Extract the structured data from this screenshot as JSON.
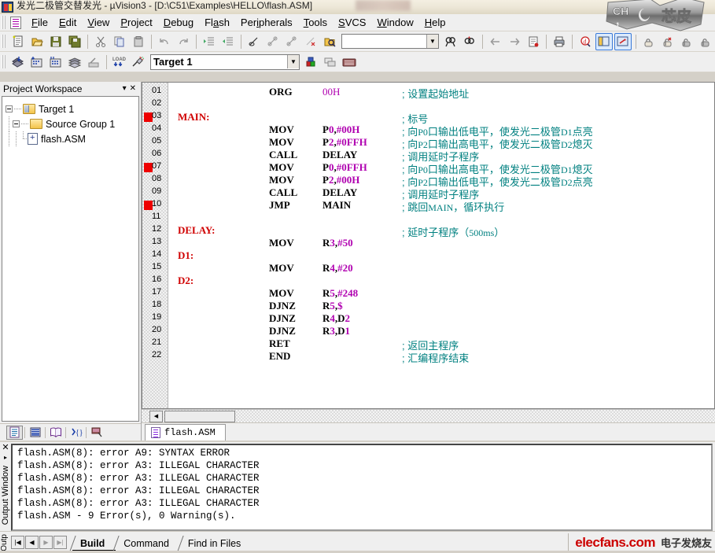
{
  "window": {
    "title": "发光二极管交替发光 - µVision3 - [D:\\C51\\Examples\\HELLO\\flash.ASM]",
    "app_icon": "uvision-icon"
  },
  "menubar": {
    "doc_icon": "document-icon",
    "items": [
      {
        "label": "File",
        "accel": "F"
      },
      {
        "label": "Edit",
        "accel": "E"
      },
      {
        "label": "View",
        "accel": "V"
      },
      {
        "label": "Project",
        "accel": "P"
      },
      {
        "label": "Debug",
        "accel": "D"
      },
      {
        "label": "Flash",
        "accel": "a"
      },
      {
        "label": "Peripherals",
        "accel": "i"
      },
      {
        "label": "Tools",
        "accel": "T"
      },
      {
        "label": "SVCS",
        "accel": "S"
      },
      {
        "label": "Window",
        "accel": "W"
      },
      {
        "label": "Help",
        "accel": "H"
      }
    ]
  },
  "toolbar_file": {
    "buttons": [
      "new-file-icon",
      "open-file-icon",
      "save-icon",
      "save-all-icon",
      "cut-icon",
      "copy-icon",
      "paste-icon",
      "undo-icon",
      "redo-icon",
      "indent-icon",
      "outdent-icon",
      "toggle-bookmark-icon",
      "next-bookmark-icon",
      "prev-bookmark-icon",
      "clear-bookmarks-icon",
      "find-in-files-icon"
    ],
    "find_value": "",
    "find_placeholder": "",
    "buttons_right": [
      "find-icon",
      "find-next-icon",
      "back-icon",
      "forward-icon",
      "goto-icon",
      "print-icon",
      "about-icon",
      "project-window-icon",
      "output-window-icon",
      "watch-icon",
      "memory-icon",
      "serial-icon",
      "symbols-icon"
    ]
  },
  "toolbar_build": {
    "buttons": [
      "translate-icon",
      "build-icon",
      "rebuild-all-icon",
      "batch-build-icon",
      "stop-build-icon",
      "download-icon",
      "debug-start-icon"
    ],
    "target_selected": "Target 1",
    "target_options": [
      "Target 1"
    ],
    "buttons_right": [
      "target-options-icon",
      "manage-components-icon",
      "keyboard-icon"
    ]
  },
  "workspace": {
    "title": "Project Workspace",
    "menu_icon": "chevron-down-icon",
    "close_icon": "close-icon",
    "tree": [
      {
        "label": "Target 1",
        "icon": "target-folder-icon",
        "level": 0
      },
      {
        "label": "Source Group 1",
        "icon": "folder-icon",
        "level": 1
      },
      {
        "label": "flash.ASM",
        "icon": "asm-file-icon",
        "level": 2
      }
    ],
    "bottom_tabs": [
      {
        "name": "files-tab",
        "icon": "files-icon",
        "selected": true
      },
      {
        "name": "regs-tab",
        "icon": "registers-icon",
        "selected": false
      },
      {
        "name": "books-tab",
        "icon": "books-icon",
        "selected": false
      },
      {
        "name": "functions-tab",
        "icon": "functions-icon",
        "selected": false
      },
      {
        "name": "templates-tab",
        "icon": "templates-icon",
        "selected": false
      }
    ]
  },
  "editor": {
    "file_tab": {
      "label": "flash.ASM",
      "icon": "asm-file-icon"
    },
    "breakpoint_lines": [
      3,
      7,
      10
    ],
    "lines": [
      {
        "num": "01",
        "label": "",
        "mnemonic": "ORG",
        "operand": "00H",
        "operand_num": true,
        "comment": "; 设置起始地址"
      },
      {
        "num": "02",
        "label": "",
        "mnemonic": "",
        "operand": "",
        "operand_num": false,
        "comment": ""
      },
      {
        "num": "03",
        "label": "MAIN:",
        "mnemonic": "",
        "operand": "",
        "operand_num": false,
        "comment": "; 标号"
      },
      {
        "num": "04",
        "label": "",
        "mnemonic": "MOV",
        "operand": "P0,#00H",
        "operand_num": false,
        "comment": "; 向P0口输出低电平，使发光二极管D1点亮"
      },
      {
        "num": "05",
        "label": "",
        "mnemonic": "MOV",
        "operand": "P2,#0FFH",
        "operand_num": false,
        "comment": "; 向P2口输出高电平，使发光二极管D2熄灭"
      },
      {
        "num": "06",
        "label": "",
        "mnemonic": "CALL",
        "operand": "DELAY",
        "operand_num": false,
        "comment": "; 调用延时子程序"
      },
      {
        "num": "07",
        "label": "",
        "mnemonic": "MOV",
        "operand": "P0,#0FFH",
        "operand_num": false,
        "comment": "; 向P0口输出高电平，使发光二极管D1熄灭"
      },
      {
        "num": "08",
        "label": "",
        "mnemonic": "MOV",
        "operand": "P2,#00H",
        "operand_num": false,
        "comment": "; 向P2口输出低电平，使发光二极管D2点亮"
      },
      {
        "num": "09",
        "label": "",
        "mnemonic": "CALL",
        "operand": "DELAY",
        "operand_num": false,
        "comment": "; 调用延时子程序"
      },
      {
        "num": "10",
        "label": "",
        "mnemonic": "JMP",
        "operand": "MAIN",
        "operand_num": false,
        "comment": "; 跳回MAIN，循环执行"
      },
      {
        "num": "11",
        "label": "",
        "mnemonic": "",
        "operand": "",
        "operand_num": false,
        "comment": ""
      },
      {
        "num": "12",
        "label": "DELAY:",
        "mnemonic": "",
        "operand": "",
        "operand_num": false,
        "comment": "; 延时子程序（500ms）"
      },
      {
        "num": "13",
        "label": "",
        "mnemonic": "MOV",
        "operand": "R3,#50",
        "operand_num": false,
        "comment": ""
      },
      {
        "num": "14",
        "label": "D1:",
        "mnemonic": "",
        "operand": "",
        "operand_num": false,
        "comment": ""
      },
      {
        "num": "15",
        "label": "",
        "mnemonic": "MOV",
        "operand": "R4,#20",
        "operand_num": false,
        "comment": ""
      },
      {
        "num": "16",
        "label": "D2:",
        "mnemonic": "",
        "operand": "",
        "operand_num": false,
        "comment": ""
      },
      {
        "num": "17",
        "label": "",
        "mnemonic": "MOV",
        "operand": "R5,#248",
        "operand_num": false,
        "comment": ""
      },
      {
        "num": "18",
        "label": "",
        "mnemonic": "DJNZ",
        "operand": "R5,$",
        "operand_num": false,
        "comment": ""
      },
      {
        "num": "19",
        "label": "",
        "mnemonic": "DJNZ",
        "operand": "R4,D2",
        "operand_num": false,
        "comment": ""
      },
      {
        "num": "20",
        "label": "",
        "mnemonic": "DJNZ",
        "operand": "R3,D1",
        "operand_num": false,
        "comment": ""
      },
      {
        "num": "21",
        "label": "",
        "mnemonic": "RET",
        "operand": "",
        "operand_num": false,
        "comment": "; 返回主程序"
      },
      {
        "num": "22",
        "label": "",
        "mnemonic": "END",
        "operand": "",
        "operand_num": false,
        "comment": "; 汇编程序结束"
      }
    ]
  },
  "output_window": {
    "label": "Output Window",
    "close_icon": "close-icon",
    "pin_icon": "pin-icon",
    "lines": [
      "flash.ASM(8): error A9: SYNTAX ERROR",
      "flash.ASM(8): error A3: ILLEGAL CHARACTER",
      "flash.ASM(8): error A3: ILLEGAL CHARACTER",
      "flash.ASM(8): error A3: ILLEGAL CHARACTER",
      "flash.ASM(8): error A3: ILLEGAL CHARACTER",
      "flash.ASM - 9 Error(s), 0 Warning(s)."
    ]
  },
  "bottom_bar": {
    "side_label": "Outp",
    "nav_buttons": [
      "first-icon",
      "prev-icon",
      "next-icon",
      "last-icon"
    ],
    "tabs": [
      {
        "label": "Build",
        "active": true
      },
      {
        "label": "Command",
        "active": false
      },
      {
        "label": "Find in Files",
        "active": false
      }
    ],
    "watermark": {
      "site": "elecfans.com",
      "cn": "电子发烧友"
    }
  },
  "watermark_top": {
    "text": "CH",
    "cn": "芯皮"
  },
  "colors": {
    "comment": "#008080",
    "label": "#d00000",
    "number": "#b000b0",
    "breakpoint": "#ee0000",
    "chrome": "#efefef",
    "brand_red": "#cc0000"
  }
}
